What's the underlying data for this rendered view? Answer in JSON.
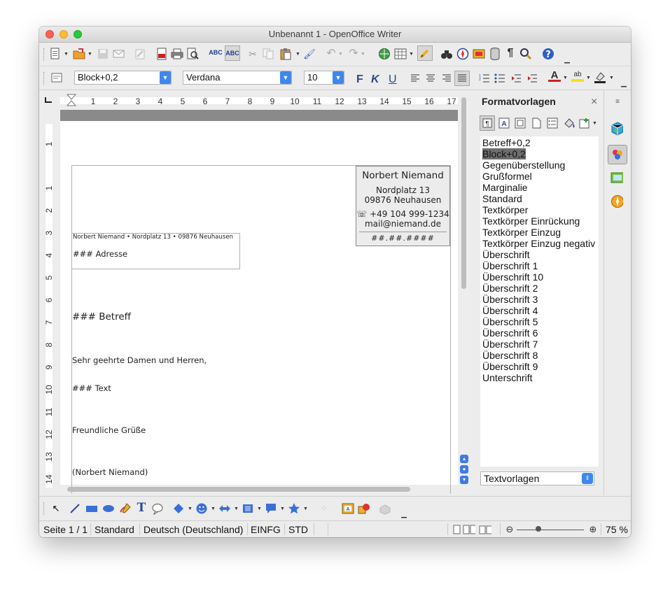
{
  "window": {
    "title": "Unbenannt 1 - OpenOffice Writer"
  },
  "toolbar2": {
    "style_value": "Block+0,2",
    "font_value": "Verdana",
    "size_value": "10",
    "bold_label": "F",
    "italic_label": "K",
    "underline_label": "U"
  },
  "ruler": {
    "h_numbers": [
      "1",
      "2",
      "3",
      "4",
      "5",
      "6",
      "7",
      "8",
      "9",
      "10",
      "11",
      "12",
      "13",
      "14",
      "15",
      "16",
      "17"
    ],
    "v_numbers": [
      "1",
      "1",
      "2",
      "3",
      "4",
      "5",
      "6",
      "7",
      "8",
      "9",
      "10",
      "11",
      "12",
      "13",
      "14"
    ]
  },
  "document": {
    "sender_name": "Norbert Niemand",
    "sender_street": "Nordplatz 13",
    "sender_city": "09876 Neuhausen",
    "sender_phone": "☏ +49 104 999-1234",
    "sender_mail": "mail@niemand.de",
    "date_field": "##.##.####",
    "return_address": "Norbert Niemand • Nordplatz 13 • 09876 Neuhausen",
    "address_placeholder": "### Adresse",
    "subject_placeholder": "### Betreff",
    "salutation": "Sehr geehrte Damen und Herren,",
    "text_placeholder": "### Text",
    "closing": "Freundliche Grüße",
    "signature": "(Norbert Niemand)"
  },
  "sidebar": {
    "title": "Formatvorlagen",
    "close": "×",
    "styles": [
      "Betreff+0,2",
      "Block+0,2",
      "Gegenüberstellung",
      "Grußformel",
      "Marginalie",
      "Standard",
      "Textkörper",
      "Textkörper Einrückung",
      "Textkörper Einzug",
      "Textkörper Einzug negativ",
      "Überschrift",
      "Überschrift 1",
      "Überschrift 10",
      "Überschrift 2",
      "Überschrift 3",
      "Überschrift 4",
      "Überschrift 5",
      "Überschrift 6",
      "Überschrift 7",
      "Überschrift 8",
      "Überschrift 9",
      "Unterschrift"
    ],
    "selected_style": "Block+0,2",
    "filter_value": "Textvorlagen"
  },
  "status": {
    "page": "Seite 1 / 1",
    "page_style": "Standard",
    "language": "Deutsch (Deutschland)",
    "insert_mode": "EINFG",
    "selection_mode": "STD",
    "zoom": "75 %"
  },
  "colors": {
    "accent": "#3e87f0",
    "selection": "#6e6e6e"
  }
}
